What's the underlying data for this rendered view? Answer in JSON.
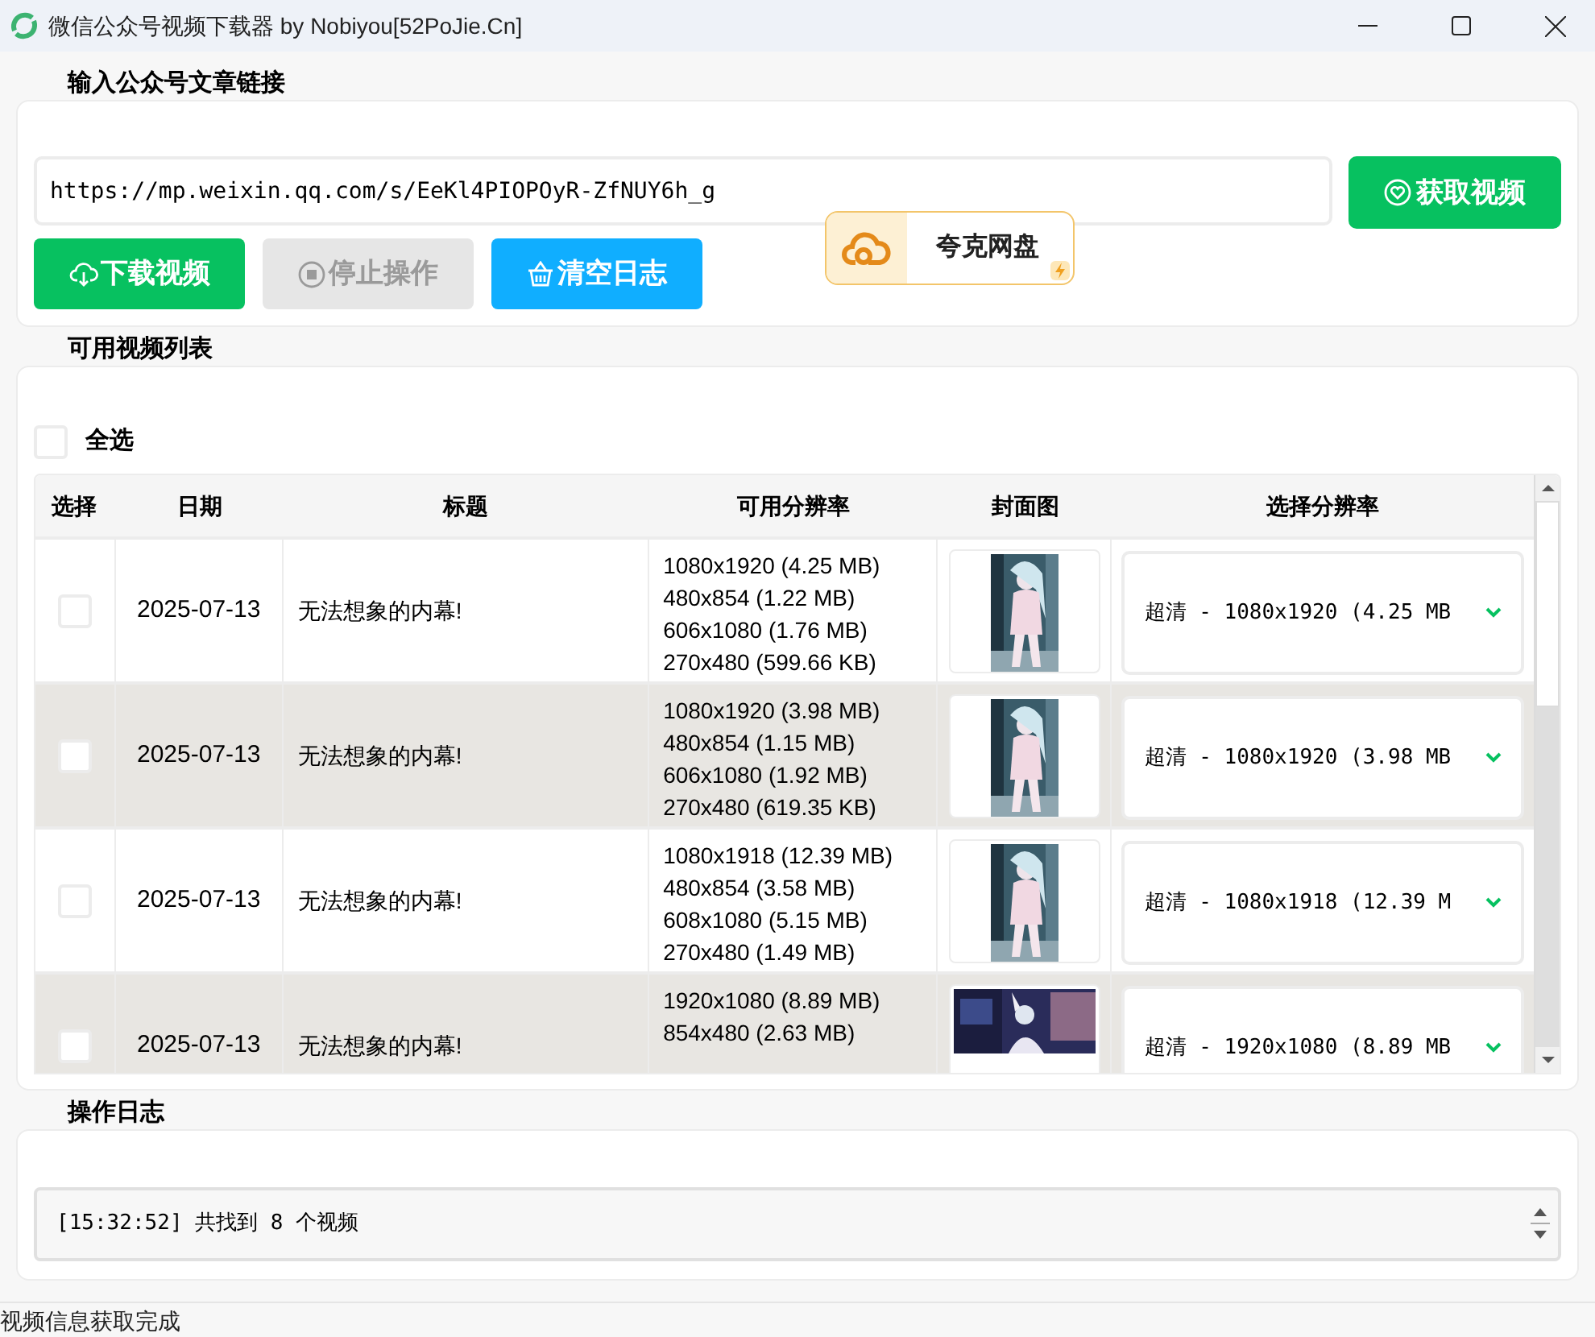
{
  "window": {
    "title": "微信公众号视频下载器 by Nobiyou[52PoJie.Cn]"
  },
  "input_section": {
    "label": "输入公众号文章链接",
    "url": "https://mp.weixin.qq.com/s/EeKl4PIOPOyR-ZfNUY6h_g",
    "fetch_button": "获取视频",
    "buttons": [
      {
        "kind": "download",
        "label": "下载视频",
        "disabled": false
      },
      {
        "kind": "stop",
        "label": "停止操作",
        "disabled": true
      },
      {
        "kind": "clear",
        "label": "清空日志",
        "disabled": false
      }
    ],
    "ad": {
      "label": "夸克网盘"
    }
  },
  "video_section": {
    "label": "可用视频列表",
    "select_all": {
      "label": "全选",
      "checked": false
    },
    "table": {
      "columns": [
        "选择",
        "日期",
        "标题",
        "可用分辨率",
        "封面图",
        "选择分辨率"
      ],
      "rows": [
        {
          "checked": false,
          "date": "2025-07-13",
          "title": "无法想象的内幕!",
          "resolutions": [
            "1080x1920 (4.25 MB)",
            "480x854 (1.22 MB)",
            "606x1080 (1.76 MB)",
            "270x480 (599.66 KB)"
          ],
          "cover": {
            "kind": "portrait"
          },
          "choice": "超清 - 1080x1920 (4.25 MB"
        },
        {
          "checked": false,
          "date": "2025-07-13",
          "title": "无法想象的内幕!",
          "resolutions": [
            "1080x1920 (3.98 MB)",
            "480x854 (1.15 MB)",
            "606x1080 (1.92 MB)",
            "270x480 (619.35 KB)"
          ],
          "cover": {
            "kind": "portrait"
          },
          "choice": "超清 - 1080x1920 (3.98 MB"
        },
        {
          "checked": false,
          "date": "2025-07-13",
          "title": "无法想象的内幕!",
          "resolutions": [
            "1080x1918 (12.39 MB)",
            "480x854 (3.58 MB)",
            "608x1080 (5.15 MB)",
            "270x480 (1.49 MB)"
          ],
          "cover": {
            "kind": "portrait"
          },
          "choice": "超清 - 1080x1918 (12.39 M"
        },
        {
          "checked": false,
          "date": "2025-07-13",
          "title": "无法想象的内幕!",
          "resolutions": [
            "1920x1080 (8.89 MB)",
            "854x480 (2.63 MB)"
          ],
          "cover": {
            "kind": "landscape"
          },
          "choice": "超清 - 1920x1080 (8.89 MB"
        }
      ]
    }
  },
  "log_section": {
    "label": "操作日志",
    "lines": [
      "[15:32:52] 共找到 8 个视频"
    ]
  },
  "status_bar": "视频信息获取完成"
}
